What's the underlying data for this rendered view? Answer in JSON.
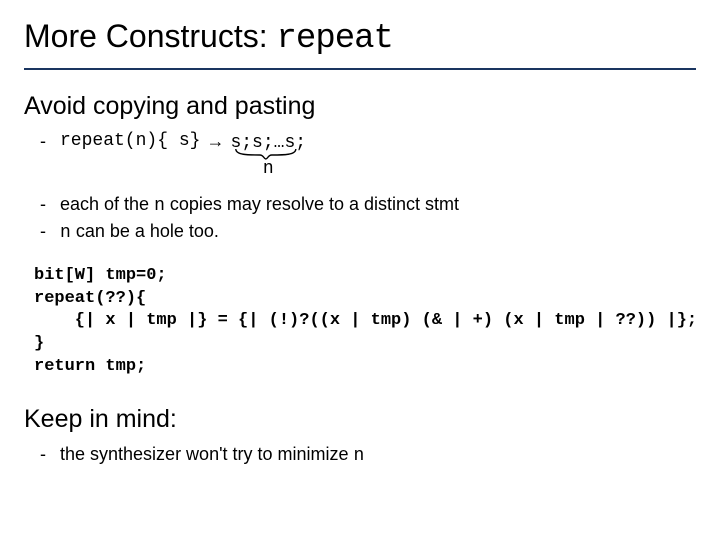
{
  "title": {
    "prefix": "More Constructs:  ",
    "code": "repeat"
  },
  "section1": {
    "heading": "Avoid copying and pasting",
    "repeat_left": "repeat(n){ s}",
    "arrow": "→",
    "expansion": "s;s;…s;",
    "brace_label": "n",
    "bullet2_a": "each of the ",
    "bullet2_b": "n",
    "bullet2_c": " copies may resolve to a distinct stmt",
    "bullet3_a": "n",
    "bullet3_b": " can be a hole too."
  },
  "code": "bit[W] tmp=0;\nrepeat(??){\n    {| x | tmp |} = {| (!)?((x | tmp) (& | +) (x | tmp | ??)) |};\n}\nreturn tmp;",
  "section2": {
    "heading": "Keep in mind:",
    "bullet_a": "the synthesizer won't try to minimize ",
    "bullet_b": "n"
  }
}
